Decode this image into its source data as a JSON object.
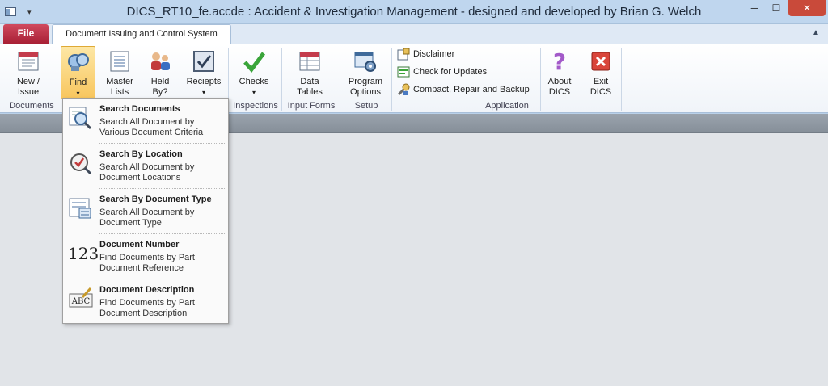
{
  "window": {
    "title": "DICS_RT10_fe.accde : Accident & Investigation Management - designed and developed by Brian G. Welch",
    "min": "─",
    "max": "☐",
    "close": "✕"
  },
  "tabs": {
    "file": "File",
    "active": "Document Issuing and Control System",
    "collapse": "▲"
  },
  "ribbon": {
    "new_issue": "New / Issue",
    "find": "Find",
    "master_lists": "Master Lists",
    "held_by": "Held By?",
    "reciepts": "Reciepts",
    "checks": "Checks",
    "data_tables": "Data Tables",
    "program_options": "Program Options",
    "disclaimer": "Disclaimer",
    "check_updates": "Check for Updates",
    "compact": "Compact, Repair and Backup",
    "about": "About DICS",
    "exit": "Exit DICS",
    "groups": {
      "documents": "Documents",
      "inspections": "Inspections",
      "input_forms": "Input Forms",
      "setup": "Setup",
      "application": "Application"
    }
  },
  "dropdown": [
    {
      "title": "Search Documents",
      "desc": "Search All Document by Various Document Criteria",
      "icon": "search-documents-icon"
    },
    {
      "title": "Search By Location",
      "desc": "Search All Document by Document Locations",
      "icon": "search-location-icon"
    },
    {
      "title": "Search By Document Type",
      "desc": "Search All Document by Document Type",
      "icon": "document-type-icon"
    },
    {
      "title": "Document Number",
      "desc": "Find Documents by Part Document Reference",
      "icon": "number-icon",
      "glyph": "123"
    },
    {
      "title": "Document Description",
      "desc": "Find Documents by Part Document Description",
      "icon": "description-icon",
      "glyph": "ABC"
    }
  ]
}
